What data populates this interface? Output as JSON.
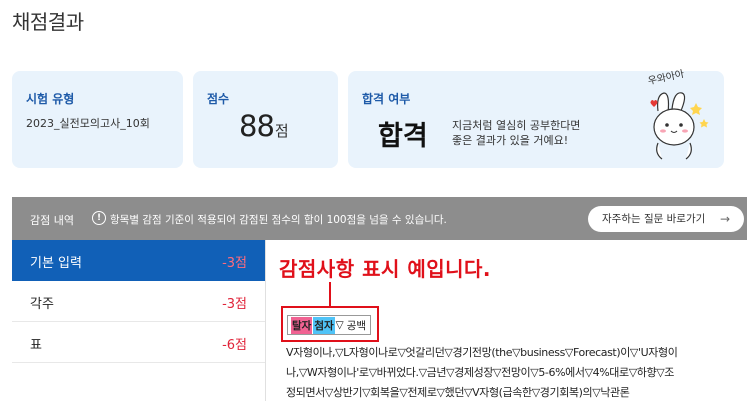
{
  "page_title": "채점결과",
  "cards": {
    "exam_type": {
      "label": "시험 유형",
      "value": "2023_실전모의고사_10회"
    },
    "score": {
      "label": "점수",
      "value": "88",
      "unit": "점"
    },
    "pass": {
      "label": "합격 여부",
      "result": "합격",
      "message_line1": "지금처럼 열심히 공부한다면",
      "message_line2": "좋은 결과가 있을 거예요!",
      "mascot_text": "우와아아"
    }
  },
  "deduction_bar": {
    "title": "감점 내역",
    "notice_icon": "!",
    "notice": "항목별 감점 기준이 적용되어 감점된 점수의 합이 100점을 넘을 수 있습니다.",
    "faq_button": "자주하는 질문 바로가기",
    "faq_arrow": "→"
  },
  "sidebar": {
    "items": [
      {
        "name": "기본 입력",
        "deduction": "-3점",
        "active": true
      },
      {
        "name": "각주",
        "deduction": "-3점",
        "active": false
      },
      {
        "name": "표",
        "deduction": "-6점",
        "active": false
      }
    ]
  },
  "content": {
    "annotation": "감점사항 표시 예입니다.",
    "legend": {
      "deleted": "탈자",
      "added": "첨자",
      "blank_symbol": "▽",
      "blank": "공백"
    },
    "text_line1": "V자형이나,▽L자형이나로▽엇갈리던▽경기전망(the▽business▽Forecast)이▽'U자형이",
    "text_line2": "나,▽W자형이나'로▽바뀌었다.▽금년▽경제성장▽전망이▽5-6%에서▽4%대로▽하향▽조",
    "text_line3": "정되면서▽상반기▽회복을▽전제로▽했던▽V자형(급속한▽경기회복)의▽낙관론"
  },
  "colors": {
    "accent_blue": "#1160b7",
    "card_bg": "#e9f3fc",
    "deduct_red": "#e0243a",
    "annotation_red": "#e0101a",
    "deleted_pink": "#f06292",
    "added_cyan": "#4fc3f7"
  }
}
